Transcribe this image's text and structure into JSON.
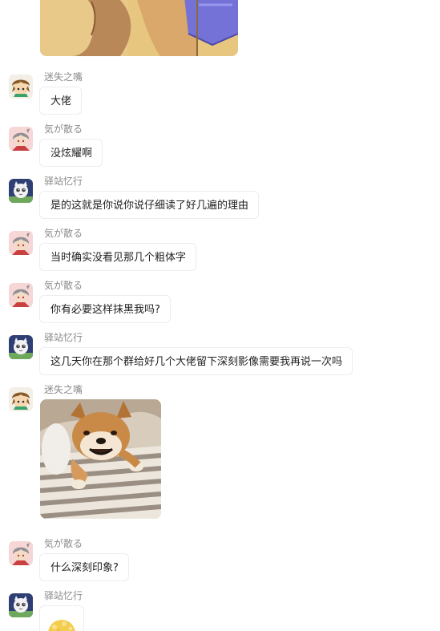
{
  "users": {
    "mishi": "迷失之嘴",
    "kiga": "気が散る",
    "yizhan": "驿站忆行"
  },
  "messages": [
    {
      "sender": "迷失之嘴",
      "text": "大佬"
    },
    {
      "sender": "気が散る",
      "text": "没炫耀啊"
    },
    {
      "sender": "驿站忆行",
      "text": "是的这就是你说你说仔细读了好几遍的理由"
    },
    {
      "sender": "気が散る",
      "text": "当时确实没看见那几个粗体字"
    },
    {
      "sender": "気が散る",
      "text": "你有必要这样抹黑我吗?"
    },
    {
      "sender": "驿站忆行",
      "text": "这几天你在那个群给好几个大佬留下深刻影像需要我再说一次吗"
    },
    {
      "sender": "迷失之嘴",
      "text": ""
    },
    {
      "sender": "気が散る",
      "text": "什么深刻印象?"
    },
    {
      "sender": "驿站忆行",
      "text": ""
    }
  ],
  "colors": {
    "name_text": "#8b8b8b",
    "bubble_border": "#ededed",
    "bubble_text": "#1f1f1f"
  },
  "icons": {
    "mishi_avatar": "brown-haired-character-icon",
    "kiga_avatar": "gray-haired-character-icon",
    "yizhan_avatar": "white-cat-character-icon",
    "sticker": "yellow-face-sticker-icon",
    "dog_photo": "shiba-dog-photo"
  }
}
